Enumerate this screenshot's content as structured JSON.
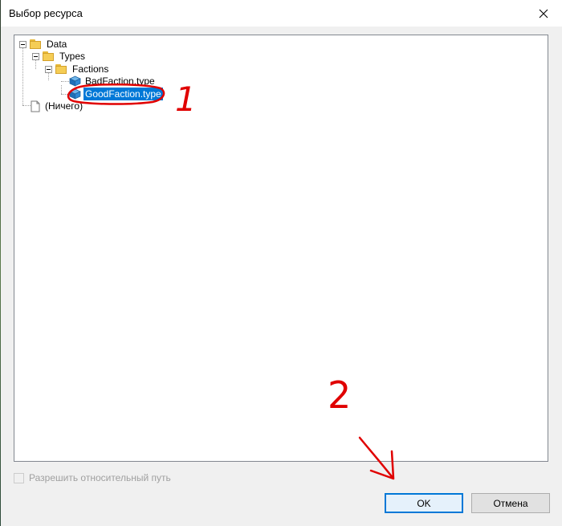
{
  "window": {
    "title": "Выбор ресурса",
    "close_glyph": "✕"
  },
  "tree": {
    "root": "Data",
    "types": "Types",
    "factions": "Factions",
    "bad_faction": "BadFaction.type",
    "good_faction": "GoodFaction.type",
    "nothing": "(Ничего)"
  },
  "options": {
    "allow_relative_path": "Разрешить относительный путь",
    "allow_relative_path_checked": false
  },
  "buttons": {
    "ok": "OK",
    "cancel": "Отмена"
  },
  "annotations": {
    "mark_1": "1",
    "mark_2": "2"
  },
  "colors": {
    "selection": "#0078d7",
    "annotation": "#e00000"
  }
}
